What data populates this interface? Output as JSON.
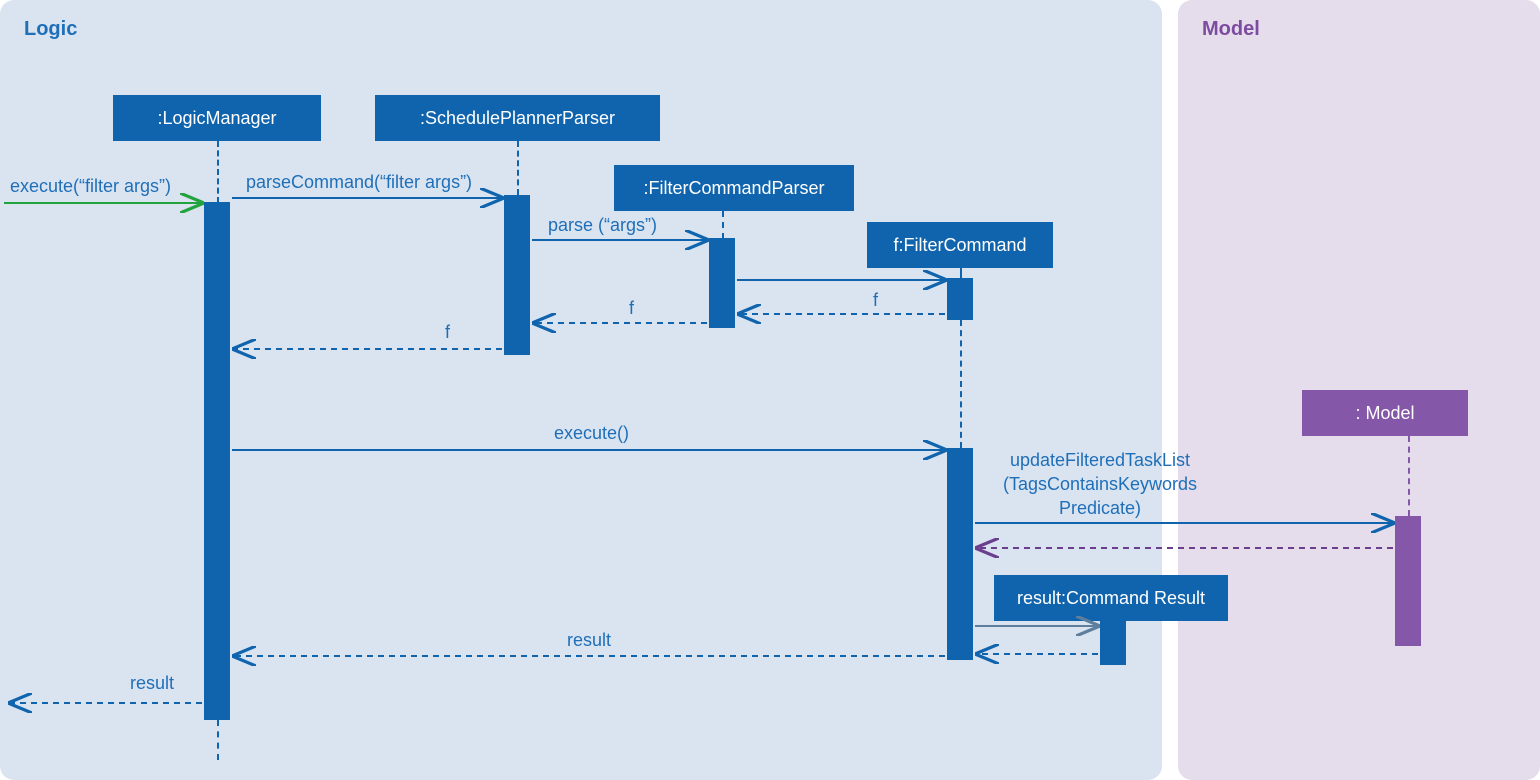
{
  "frames": {
    "logic": "Logic",
    "model": "Model"
  },
  "participants": {
    "logicManager": ":LogicManager",
    "schedulePlannerParser": ":SchedulePlannerParser",
    "filterCommandParser": ":FilterCommandParser",
    "filterCommand": "f:FilterCommand",
    "model": ": Model",
    "commandResult": "result:Command Result"
  },
  "messages": {
    "execute_entry": "execute(“filter args”)",
    "parseCommand": "parseCommand(“filter args”)",
    "parse": "parse (“args”)",
    "return_f_1": "f",
    "return_f_2": "f",
    "return_f_3": "f",
    "execute": "execute()",
    "updateFilteredTaskList_l1": "updateFilteredTaskList",
    "updateFilteredTaskList_l2": "(TagsContainsKeywords",
    "updateFilteredTaskList_l3": "Predicate)",
    "result_1": "result",
    "result_2": "result"
  },
  "colors": {
    "blue_fill": "#1064AE",
    "blue_text": "#1F6FB8",
    "purple_fill": "#8557A8",
    "purple_text": "#6B3F8E",
    "green": "#23A33E"
  }
}
